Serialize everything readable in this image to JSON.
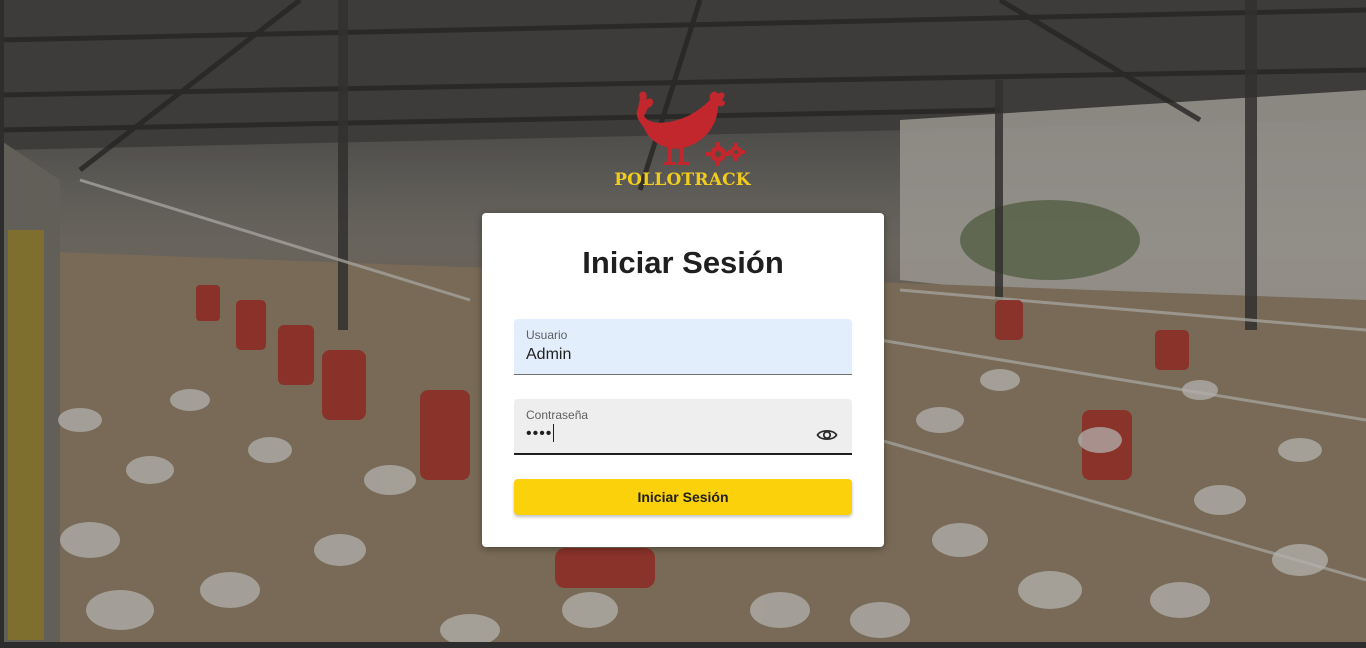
{
  "brand": {
    "name": "POLLOTRACK",
    "colors": {
      "logo_red": "#c1272d",
      "logo_gold": "#f2cc1d",
      "accent": "#fbd10c"
    }
  },
  "login": {
    "title": "Iniciar Sesión",
    "username": {
      "label": "Usuario",
      "value": "Admin"
    },
    "password": {
      "label": "Contraseña",
      "masked_value": "••••",
      "toggle_icon": "eye-icon"
    },
    "submit_label": "Iniciar Sesión"
  },
  "background": {
    "scene": "poultry-farm-photo"
  }
}
